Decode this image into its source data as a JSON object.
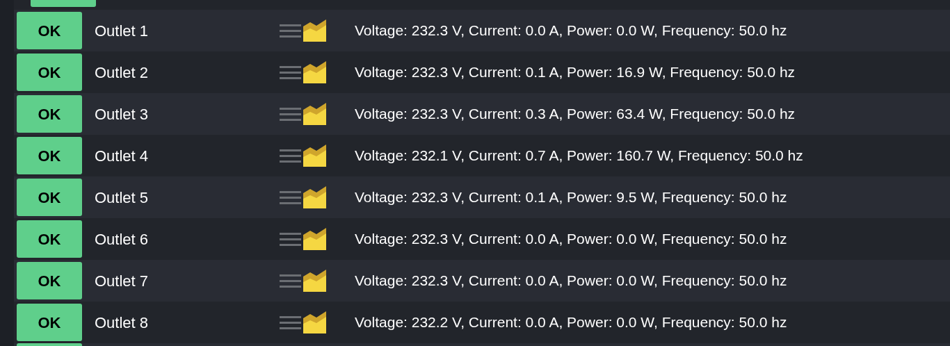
{
  "outlets": [
    {
      "status": "OK",
      "name": "Outlet 1",
      "reading": "Voltage: 232.3 V, Current: 0.0 A, Power: 0.0 W, Frequency: 50.0 hz"
    },
    {
      "status": "OK",
      "name": "Outlet 2",
      "reading": "Voltage: 232.3 V, Current: 0.1 A, Power: 16.9 W, Frequency: 50.0 hz"
    },
    {
      "status": "OK",
      "name": "Outlet 3",
      "reading": "Voltage: 232.3 V, Current: 0.3 A, Power: 63.4 W, Frequency: 50.0 hz"
    },
    {
      "status": "OK",
      "name": "Outlet 4",
      "reading": "Voltage: 232.1 V, Current: 0.7 A, Power: 160.7 W, Frequency: 50.0 hz"
    },
    {
      "status": "OK",
      "name": "Outlet 5",
      "reading": "Voltage: 232.3 V, Current: 0.1 A, Power: 9.5 W, Frequency: 50.0 hz"
    },
    {
      "status": "OK",
      "name": "Outlet 6",
      "reading": "Voltage: 232.3 V, Current: 0.0 A, Power: 0.0 W, Frequency: 50.0 hz"
    },
    {
      "status": "OK",
      "name": "Outlet 7",
      "reading": "Voltage: 232.3 V, Current: 0.0 A, Power: 0.0 W, Frequency: 50.0 hz"
    },
    {
      "status": "OK",
      "name": "Outlet 8",
      "reading": "Voltage: 232.2 V, Current: 0.0 A, Power: 0.0 W, Frequency: 50.0 hz"
    }
  ]
}
